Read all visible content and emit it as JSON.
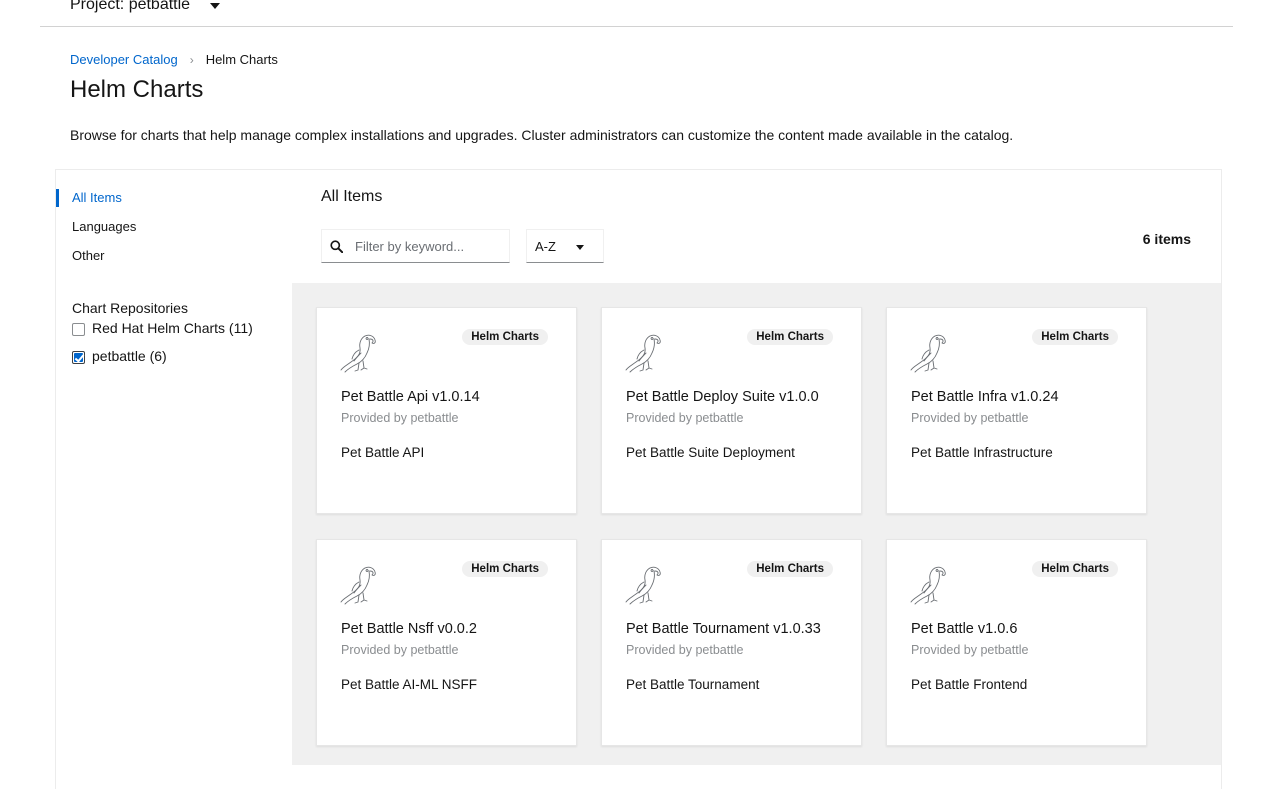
{
  "header": {
    "project_label": "Project: petbattle"
  },
  "breadcrumb": {
    "parent": "Developer Catalog",
    "current": "Helm Charts"
  },
  "page": {
    "title": "Helm Charts",
    "description": "Browse for charts that help manage complex installations and upgrades. Cluster administrators can customize the content made available in the catalog."
  },
  "sidebar": {
    "items": [
      {
        "label": "All Items",
        "active": true
      },
      {
        "label": "Languages"
      },
      {
        "label": "Other"
      }
    ],
    "repositories_title": "Chart Repositories",
    "repositories": [
      {
        "label": "Red Hat Helm Charts (11)",
        "checked": false
      },
      {
        "label": "petbattle (6)",
        "checked": true
      }
    ]
  },
  "main": {
    "title": "All Items",
    "search_placeholder": "Filter by keyword...",
    "sort_value": "A-Z",
    "count": "6 items"
  },
  "tiles": [
    {
      "badge": "Helm Charts",
      "name": "Pet Battle Api v1.0.14",
      "provider": "Provided by petbattle",
      "description": "Pet Battle API",
      "icon": "parrot-logo-icon"
    },
    {
      "badge": "Helm Charts",
      "name": "Pet Battle Deploy Suite v1.0.0",
      "provider": "Provided by petbattle",
      "description": "Pet Battle Suite Deployment",
      "icon": "parrot-logo-icon"
    },
    {
      "badge": "Helm Charts",
      "name": "Pet Battle Infra v1.0.24",
      "provider": "Provided by petbattle",
      "description": "Pet Battle Infrastructure",
      "icon": "parrot-logo-icon"
    },
    {
      "badge": "Helm Charts",
      "name": "Pet Battle Nsff v0.0.2",
      "provider": "Provided by petbattle",
      "description": "Pet Battle AI-ML NSFF",
      "icon": "parrot-logo-icon"
    },
    {
      "badge": "Helm Charts",
      "name": "Pet Battle Tournament v1.0.33",
      "provider": "Provided by petbattle",
      "description": "Pet Battle Tournament",
      "icon": "parrot-logo-icon"
    },
    {
      "badge": "Helm Charts",
      "name": "Pet Battle v1.0.6",
      "provider": "Provided by petbattle",
      "description": "Pet Battle Frontend",
      "icon": "parrot-logo-icon"
    }
  ],
  "colors": {
    "link": "#0066cc",
    "tiles_background": "#f0f0f0",
    "muted_text": "#8a8d90"
  }
}
